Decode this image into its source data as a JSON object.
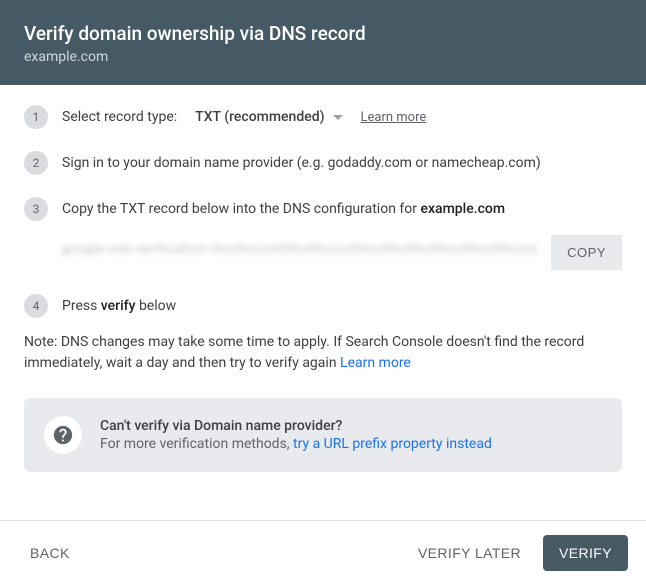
{
  "header": {
    "title": "Verify domain ownership via DNS record",
    "subtitle": "example.com"
  },
  "steps": {
    "s1": {
      "num": "1",
      "label": "Select record type:"
    },
    "s2": {
      "num": "2",
      "text": "Sign in to your domain name provider (e.g. godaddy.com or namecheap.com)"
    },
    "s3": {
      "num": "3",
      "prefix": "Copy the TXT record below into the DNS configuration for ",
      "domain": "example.com"
    },
    "s4": {
      "num": "4",
      "prefix": "Press ",
      "bold": "verify",
      "suffix": " below"
    }
  },
  "record_type": {
    "selected": "TXT (recommended)",
    "learn_more": "Learn more"
  },
  "txt_record": {
    "value_blurred": "google-site-verification=XxxXxxxxXXXxXXxxxxXXxxXXxXXxXXxxXXxxXXxxxx",
    "copy_label": "COPY"
  },
  "note": {
    "text": "Note: DNS changes may take some time to apply. If Search Console doesn't find the record immediately, wait a day and then try to verify again ",
    "link": "Learn more"
  },
  "alt": {
    "title": "Can't verify via Domain name provider?",
    "sub_prefix": "For more verification methods, ",
    "sub_link": "try a URL prefix property instead"
  },
  "footer": {
    "back": "BACK",
    "verify_later": "VERIFY LATER",
    "verify": "VERIFY"
  }
}
